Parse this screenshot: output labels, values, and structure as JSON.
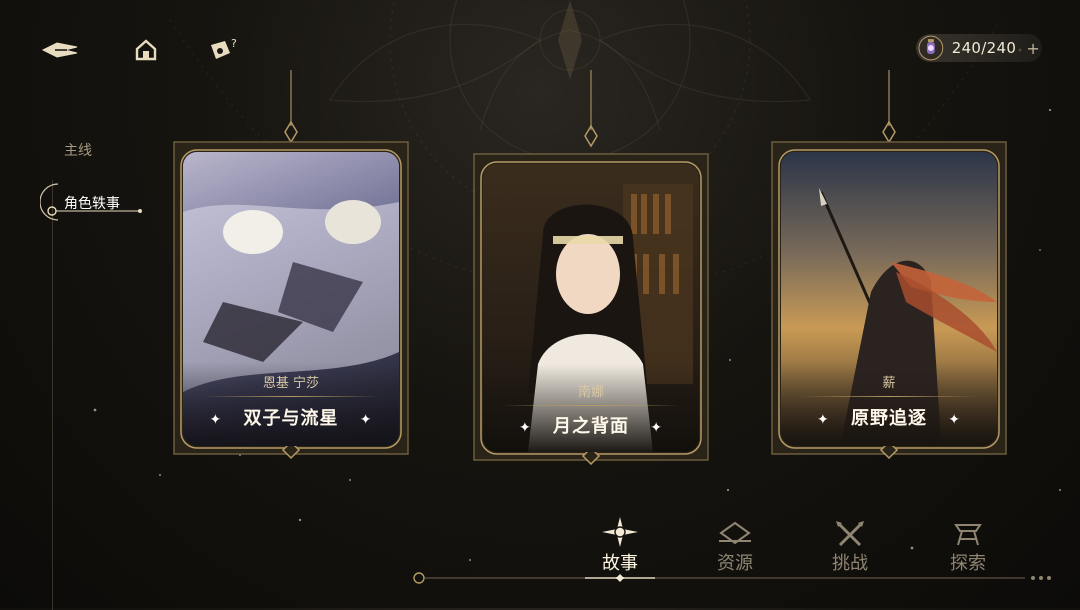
{
  "top_bar": {
    "back_icon": "back-arrow-icon",
    "home_icon": "home-icon",
    "help_icon": "help-icon",
    "stamina": {
      "icon": "lantern-icon",
      "value": "240/240",
      "plus": "+"
    }
  },
  "side_nav": {
    "items": [
      {
        "label": "主线",
        "active": false
      },
      {
        "label": "角色轶事",
        "active": true
      }
    ]
  },
  "cards": [
    {
      "subtitle": "恩基 宁莎",
      "title": "双子与流星",
      "art": "twins-sleeping-art"
    },
    {
      "subtitle": "南娜",
      "title": "月之背面",
      "art": "girl-library-art"
    },
    {
      "subtitle": "薪",
      "title": "原野追逐",
      "art": "spear-warrior-art"
    }
  ],
  "bottom_tabs": [
    {
      "label": "故事",
      "icon": "star-compass-icon",
      "active": true
    },
    {
      "label": "资源",
      "icon": "resource-icon",
      "active": false
    },
    {
      "label": "挑战",
      "icon": "crossed-swords-icon",
      "active": false
    },
    {
      "label": "探索",
      "icon": "explore-icon",
      "active": false
    }
  ],
  "colors": {
    "gold": "#b59a66",
    "frame_dark": "#2a2418",
    "text_light": "#fff8ea"
  }
}
